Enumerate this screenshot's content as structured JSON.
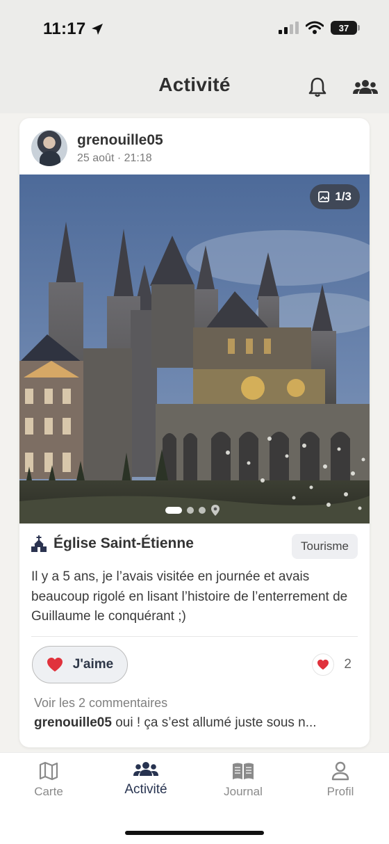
{
  "status_bar": {
    "time": "11:17",
    "battery": "37"
  },
  "header": {
    "title": "Activité"
  },
  "post": {
    "username": "grenouille05",
    "datetime": "25 août · 21:18",
    "image_counter": "1/3",
    "carousel": {
      "total": 3,
      "active_index": 0
    },
    "place_name": "Église Saint-Étienne",
    "category_tag": "Tourisme",
    "text": "Il y a 5 ans, je l’avais visitée en journée et avais beaucoup rigolé en lisant l’histoire de l’enterrement de Guillaume le conquérant ;)",
    "like_label": "J'aime",
    "like_count": "2",
    "comments_link": "Voir les 2 commentaires",
    "comment_author": "grenouille05",
    "comment_text": "oui ! ça s’est allumé juste sous n..."
  },
  "tabs": [
    {
      "label": "Carte",
      "icon": "map-icon"
    },
    {
      "label": "Activité",
      "icon": "people-icon",
      "active": true
    },
    {
      "label": "Journal",
      "icon": "book-icon"
    },
    {
      "label": "Profil",
      "icon": "user-icon"
    }
  ],
  "colors": {
    "accent": "#273350",
    "heart": "#e0323c",
    "background": "#f3f2ef"
  }
}
